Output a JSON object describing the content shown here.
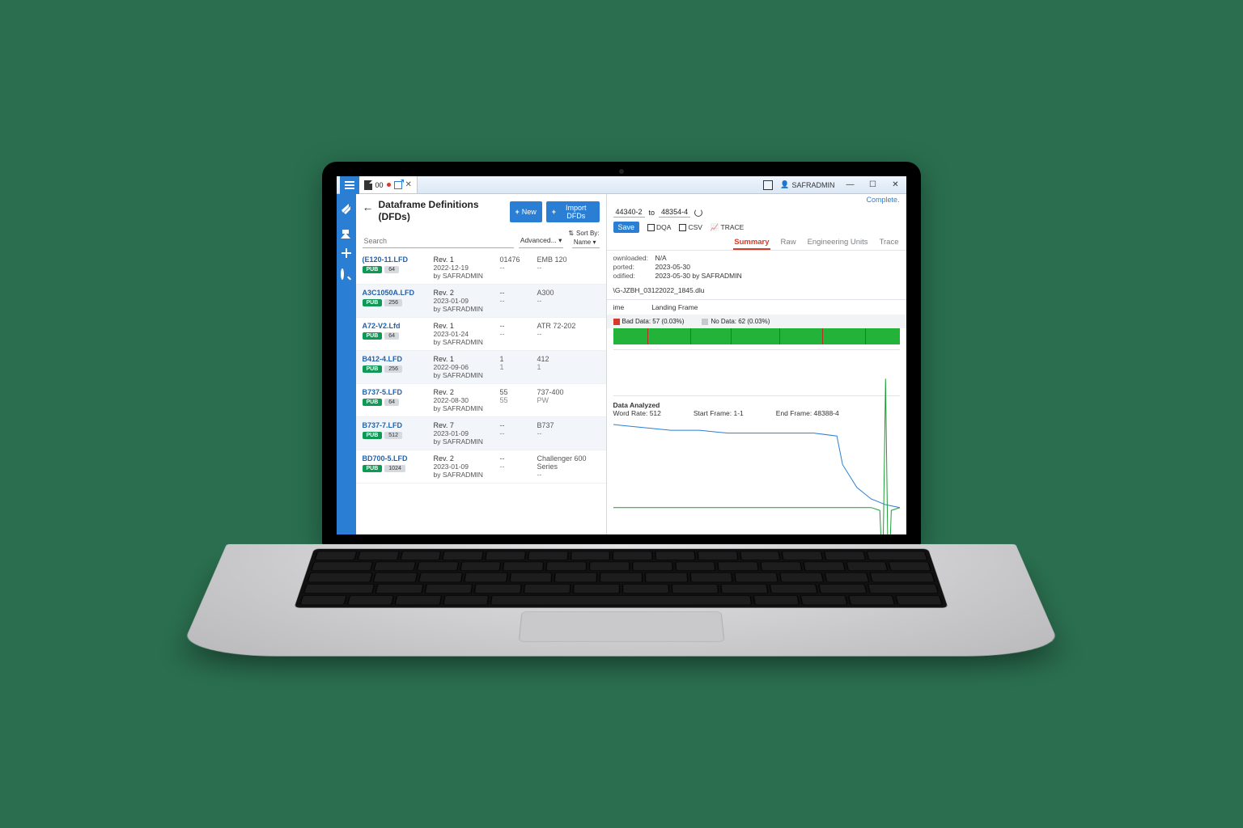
{
  "titlebar": {
    "tab_label": "00",
    "user_label": "SAFRADMIN"
  },
  "left": {
    "title": "Dataframe Definitions (DFDs)",
    "new_btn": "New",
    "import_btn": "Import DFDs",
    "search_placeholder": "Search",
    "advanced_label": "Advanced...",
    "sort_by_label": "Sort By:",
    "sort_value": "Name",
    "rows": [
      {
        "name": "(E120-11.LFD",
        "pub": "PUB",
        "count": "64",
        "rev": "Rev. 1",
        "date": "2022-12-19",
        "by": "by SAFRADMIN",
        "col3a": "01476",
        "col3b": "--",
        "col4a": "EMB 120",
        "col4b": "--"
      },
      {
        "name": "A3C1050A.LFD",
        "pub": "PUB",
        "count": "256",
        "rev": "Rev. 2",
        "date": "2023-01-09",
        "by": "by SAFRADMIN",
        "col3a": "--",
        "col3b": "--",
        "col4a": "A300",
        "col4b": "--"
      },
      {
        "name": "A72-V2.Lfd",
        "pub": "PUB",
        "count": "64",
        "rev": "Rev. 1",
        "date": "2023-01-24",
        "by": "by SAFRADMIN",
        "col3a": "--",
        "col3b": "--",
        "col4a": "ATR 72-202",
        "col4b": "--"
      },
      {
        "name": "B412-4.LFD",
        "pub": "PUB",
        "count": "256",
        "rev": "Rev. 1",
        "date": "2022-09-06",
        "by": "by SAFRADMIN",
        "col3a": "1",
        "col3b": "1",
        "col4a": "412",
        "col4b": "1"
      },
      {
        "name": "B737-5.LFD",
        "pub": "PUB",
        "count": "64",
        "rev": "Rev. 2",
        "date": "2022-08-30",
        "by": "by SAFRADMIN",
        "col3a": "55",
        "col3b": "55",
        "col4a": "737-400",
        "col4b": "PW"
      },
      {
        "name": "B737-7.LFD",
        "pub": "PUB",
        "count": "512",
        "rev": "Rev. 7",
        "date": "2023-01-09",
        "by": "by SAFRADMIN",
        "col3a": "--",
        "col3b": "--",
        "col4a": "B737",
        "col4b": "--"
      },
      {
        "name": "BD700-5.LFD",
        "pub": "PUB",
        "count": "1024",
        "rev": "Rev. 2",
        "date": "2023-01-09",
        "by": "by SAFRADMIN",
        "col3a": "--",
        "col3b": "--",
        "col4a": "Challenger 600 Series",
        "col4b": "--"
      }
    ]
  },
  "right": {
    "status": "Complete.",
    "range_from": "44340-2",
    "range_to_label": "to",
    "range_to": "48354-4",
    "save_label": "Save",
    "dqa_label": "DQA",
    "csv_label": "CSV",
    "trace_label": "TRACE",
    "tabs": {
      "summary": "Summary",
      "raw": "Raw",
      "eng": "Engineering Units",
      "trace": "Trace"
    },
    "meta": {
      "downloaded_k": "ownloaded:",
      "downloaded_v": "N/A",
      "ported_k": "ported:",
      "ported_v": "2023-05-30",
      "modified_k": "odified:",
      "modified_v": "2023-05-30 by SAFRADMIN"
    },
    "filepath": "\\G-JZBH_03122022_1845.dlu",
    "frame_hdr1": "ime",
    "frame_hdr2": "Landing Frame",
    "legend_bad": "Bad Data: 57 (0.03%)",
    "legend_nodata": "No Data: 62 (0.03%)",
    "footer": {
      "analyzed_lbl": "Data Analyzed",
      "wordrate_lbl": "Word Rate: 512",
      "start_lbl": "Start Frame: 1-1",
      "end_lbl": "End Frame: 48388-4"
    }
  },
  "chart_data": {
    "type": "line",
    "title": "",
    "xlabel": "",
    "ylabel": "",
    "series": [
      {
        "name": "blue",
        "color": "#2a7fd4",
        "x": [
          0,
          10,
          20,
          30,
          40,
          50,
          60,
          70,
          78,
          80,
          85,
          90,
          95,
          100
        ],
        "values": [
          74,
          73,
          72,
          72,
          71,
          71,
          71,
          71,
          70,
          60,
          52,
          48,
          46,
          45
        ]
      },
      {
        "name": "green",
        "color": "#1f9b37",
        "x": [
          0,
          10,
          20,
          30,
          40,
          50,
          60,
          70,
          80,
          90,
          93,
          94,
          95,
          96,
          97,
          100
        ],
        "values": [
          45,
          45,
          45,
          45,
          45,
          45,
          45,
          45,
          45,
          45,
          44,
          20,
          90,
          15,
          44,
          45
        ]
      }
    ],
    "xlim": [
      0,
      100
    ],
    "ylim": [
      0,
      100
    ]
  }
}
